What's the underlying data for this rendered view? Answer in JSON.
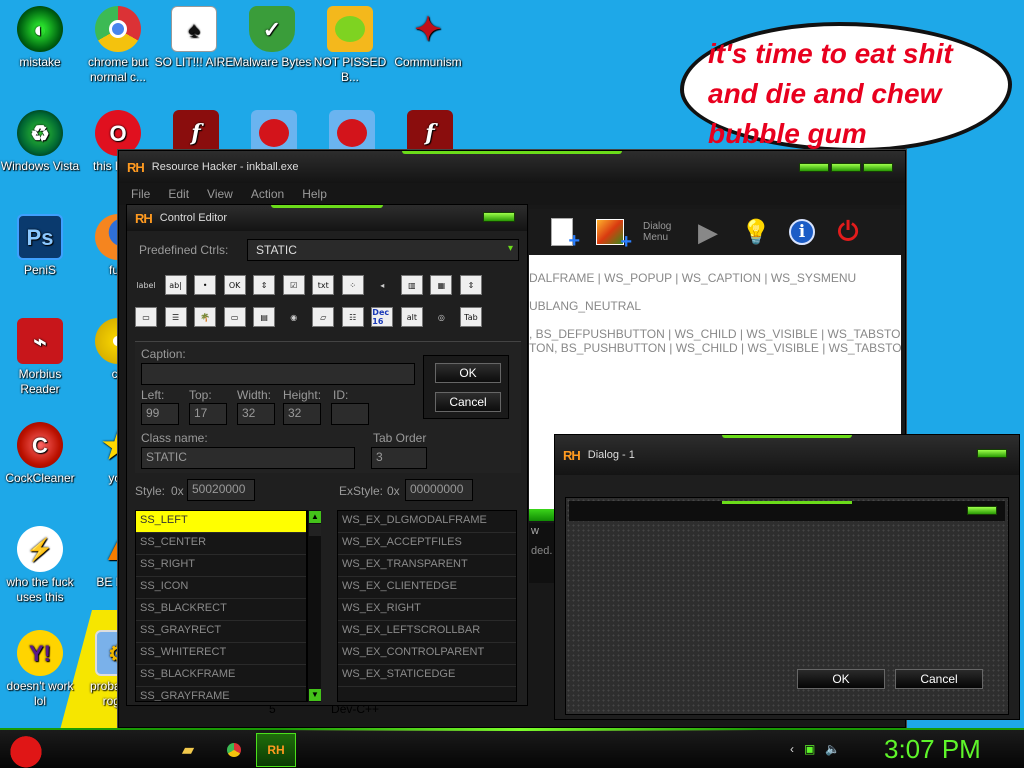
{
  "desktop": {
    "icons": [
      {
        "label": "mistake",
        "icon": "green-orb-icon"
      },
      {
        "label": "chrome but normal c...",
        "icon": "chrome-icon"
      },
      {
        "label": "SO LIT!!! AIRE",
        "icon": "solitaire-icon"
      },
      {
        "label": "Malware Bytes",
        "icon": "shield-check-icon"
      },
      {
        "label": "NOT PISSED B...",
        "icon": "green-pig-icon"
      },
      {
        "label": "Communism",
        "icon": "red-emblem-icon"
      },
      {
        "label": "Windows Vista",
        "icon": "recycle-icon"
      },
      {
        "label": "this like a",
        "icon": "opera-icon"
      },
      {
        "label": "PeniS",
        "icon": "photoshop-icon"
      },
      {
        "label": "furr",
        "icon": "firefox-icon"
      },
      {
        "label": "Morbius Reader",
        "icon": "acrobat-icon"
      },
      {
        "label": "cd",
        "icon": "cd-icon"
      },
      {
        "label": "CockCleaner",
        "icon": "ccleaner-icon"
      },
      {
        "label": "you",
        "icon": "star-icon"
      },
      {
        "label": "who the fuck uses this",
        "icon": "lightning-icon"
      },
      {
        "label": "BE BEE",
        "icon": "vlc-icon"
      },
      {
        "label": "doesn't work lol",
        "icon": "yahoo-messenger-icon"
      },
      {
        "label": "probably a rogue",
        "icon": "monitor-gear-icon"
      }
    ],
    "bubble_text": "it's time to eat shit and die and chew bubble gum"
  },
  "main_window": {
    "title": "Resource Hacker - inkball.exe",
    "logo": "RH",
    "menu": [
      "File",
      "Edit",
      "View",
      "Action",
      "Help"
    ],
    "toolbar_dialog_label": "Dialog Menu",
    "editor_lines": [
      "DALFRAME | WS_POPUP | WS_CAPTION | WS_SYSMENU",
      "",
      "UBLANG_NEUTRAL",
      "",
      ", BS_DEFPUSHBUTTON | WS_CHILD | WS_VISIBLE | WS_TABSTO",
      "TON, BS_PUSHBUTTON | WS_CHILD | WS_VISIBLE | WS_TABSTO"
    ],
    "log_fragments": [
      "w",
      "ded."
    ],
    "status_fragments": [
      "5",
      "Dev-C++"
    ]
  },
  "control_editor": {
    "title": "Control Editor",
    "logo": "RH",
    "predefined_label": "Predefined Ctrls:",
    "predefined_value": "STATIC",
    "controls_row1": [
      "label",
      "ab|",
      "•",
      "OK",
      "⇕",
      "☑",
      "txt",
      "⁘",
      "◂",
      "▥",
      "▦",
      "⇕",
      ""
    ],
    "controls_row2": [
      "▭",
      "☰",
      "🌴",
      "▭",
      "▤",
      "◉",
      "▱",
      "☷",
      "Dec 16",
      "alt",
      "◎",
      "Tab",
      ""
    ],
    "caption_label": "Caption:",
    "caption_value": "",
    "left_label": "Left:",
    "left_value": "99",
    "top_label": "Top:",
    "top_value": "17",
    "width_label": "Width:",
    "width_value": "32",
    "height_label": "Height:",
    "height_value": "32",
    "id_label": "ID:",
    "id_value": "",
    "ok_label": "OK",
    "cancel_label": "Cancel",
    "classname_label": "Class name:",
    "classname_value": "STATIC",
    "taborder_label": "Tab Order",
    "taborder_value": "3",
    "style_label": "Style:",
    "style_prefix": "0x",
    "style_value": "50020000",
    "exstyle_label": "ExStyle:",
    "exstyle_prefix": "0x",
    "exstyle_value": "00000000",
    "styles": [
      "SS_LEFT",
      "SS_CENTER",
      "SS_RIGHT",
      "SS_ICON",
      "SS_BLACKRECT",
      "SS_GRAYRECT",
      "SS_WHITERECT",
      "SS_BLACKFRAME",
      "SS_GRAYFRAME"
    ],
    "exstyles": [
      "WS_EX_DLGMODALFRAME",
      "WS_EX_ACCEPTFILES",
      "WS_EX_TRANSPARENT",
      "WS_EX_CLIENTEDGE",
      "WS_EX_RIGHT",
      "WS_EX_LEFTSCROLLBAR",
      "WS_EX_CONTROLPARENT",
      "WS_EX_STATICEDGE"
    ]
  },
  "dialog": {
    "title": "Dialog - 1",
    "logo": "RH",
    "ok_label": "OK",
    "cancel_label": "Cancel"
  },
  "taskbar": {
    "rh_label": "RH",
    "clock": "3:07 PM"
  },
  "colors": {
    "desktop": "#1ea8e8",
    "accent_green": "#6bdc1a",
    "selection": "#ffff00",
    "clock": "#5ef52a"
  }
}
